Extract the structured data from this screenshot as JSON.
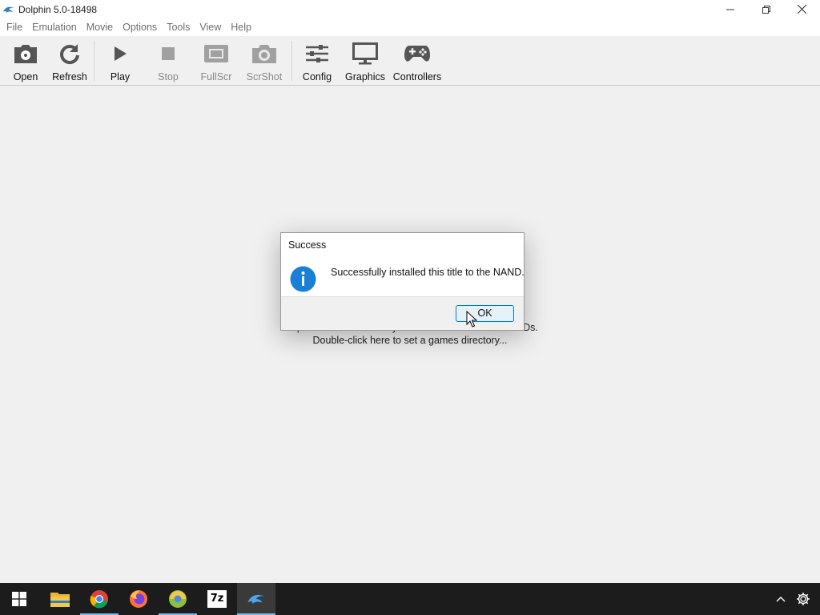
{
  "window": {
    "title": "Dolphin 5.0-18498"
  },
  "menu": {
    "items": [
      "File",
      "Emulation",
      "Movie",
      "Options",
      "Tools",
      "View",
      "Help"
    ]
  },
  "toolbar": {
    "buttons": [
      {
        "label": "Open",
        "icon": "disc-open-icon",
        "enabled": true
      },
      {
        "label": "Refresh",
        "icon": "refresh-icon",
        "enabled": true
      },
      {
        "label": "Play",
        "icon": "play-icon",
        "enabled": true
      },
      {
        "label": "Stop",
        "icon": "stop-icon",
        "enabled": false
      },
      {
        "label": "FullScr",
        "icon": "fullscreen-icon",
        "enabled": false
      },
      {
        "label": "ScrShot",
        "icon": "camera-icon",
        "enabled": false
      },
      {
        "label": "Config",
        "icon": "sliders-icon",
        "enabled": true
      },
      {
        "label": "Graphics",
        "icon": "monitor-icon",
        "enabled": true
      },
      {
        "label": "Controllers",
        "icon": "gamepad-icon",
        "enabled": true
      }
    ]
  },
  "main": {
    "empty_line1": "Dolphin could not find any GameCube/Wii ISOs or WADs.",
    "empty_line2": "Double-click here to set a games directory..."
  },
  "dialog": {
    "title": "Success",
    "message": "Successfully installed this title to the NAND.",
    "ok_label": "OK",
    "icon": "info-icon"
  },
  "taskbar": {
    "items": [
      "start-icon",
      "file-explorer-icon",
      "chrome-icon",
      "firefox-icon",
      "browser-icon",
      "7zip-icon",
      "dolphin-icon"
    ],
    "seven_zip_label": "7z",
    "tray": [
      "chevron-up-icon",
      "gear-icon"
    ]
  },
  "colors": {
    "accent": "#0078d7",
    "info_icon": "#1a7fd6",
    "taskbar": "#1c1c1c"
  }
}
